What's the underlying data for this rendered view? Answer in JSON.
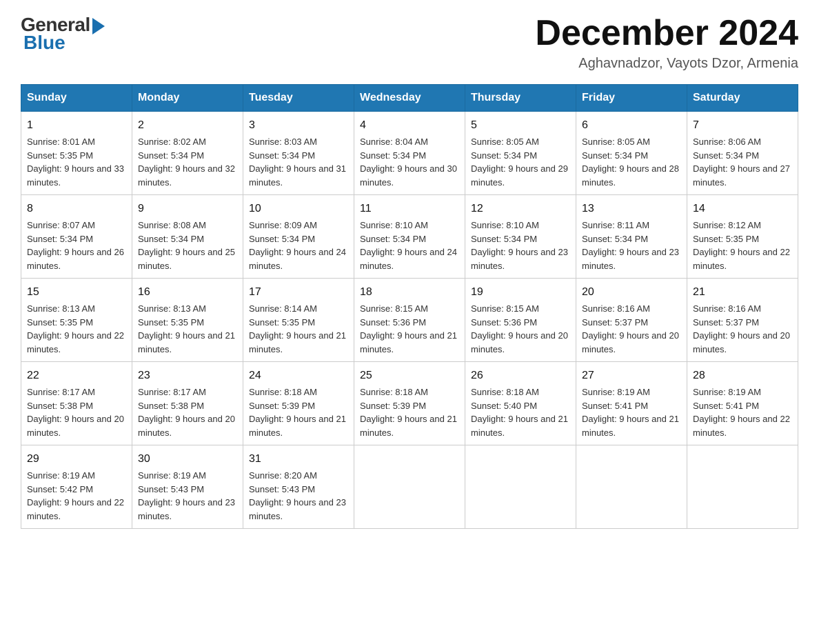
{
  "header": {
    "logo_general": "General",
    "logo_blue": "Blue",
    "main_title": "December 2024",
    "subtitle": "Aghavnadzor, Vayots Dzor, Armenia"
  },
  "calendar": {
    "days_of_week": [
      "Sunday",
      "Monday",
      "Tuesday",
      "Wednesday",
      "Thursday",
      "Friday",
      "Saturday"
    ],
    "weeks": [
      [
        {
          "day": "1",
          "sunrise": "8:01 AM",
          "sunset": "5:35 PM",
          "daylight": "9 hours and 33 minutes."
        },
        {
          "day": "2",
          "sunrise": "8:02 AM",
          "sunset": "5:34 PM",
          "daylight": "9 hours and 32 minutes."
        },
        {
          "day": "3",
          "sunrise": "8:03 AM",
          "sunset": "5:34 PM",
          "daylight": "9 hours and 31 minutes."
        },
        {
          "day": "4",
          "sunrise": "8:04 AM",
          "sunset": "5:34 PM",
          "daylight": "9 hours and 30 minutes."
        },
        {
          "day": "5",
          "sunrise": "8:05 AM",
          "sunset": "5:34 PM",
          "daylight": "9 hours and 29 minutes."
        },
        {
          "day": "6",
          "sunrise": "8:05 AM",
          "sunset": "5:34 PM",
          "daylight": "9 hours and 28 minutes."
        },
        {
          "day": "7",
          "sunrise": "8:06 AM",
          "sunset": "5:34 PM",
          "daylight": "9 hours and 27 minutes."
        }
      ],
      [
        {
          "day": "8",
          "sunrise": "8:07 AM",
          "sunset": "5:34 PM",
          "daylight": "9 hours and 26 minutes."
        },
        {
          "day": "9",
          "sunrise": "8:08 AM",
          "sunset": "5:34 PM",
          "daylight": "9 hours and 25 minutes."
        },
        {
          "day": "10",
          "sunrise": "8:09 AM",
          "sunset": "5:34 PM",
          "daylight": "9 hours and 24 minutes."
        },
        {
          "day": "11",
          "sunrise": "8:10 AM",
          "sunset": "5:34 PM",
          "daylight": "9 hours and 24 minutes."
        },
        {
          "day": "12",
          "sunrise": "8:10 AM",
          "sunset": "5:34 PM",
          "daylight": "9 hours and 23 minutes."
        },
        {
          "day": "13",
          "sunrise": "8:11 AM",
          "sunset": "5:34 PM",
          "daylight": "9 hours and 23 minutes."
        },
        {
          "day": "14",
          "sunrise": "8:12 AM",
          "sunset": "5:35 PM",
          "daylight": "9 hours and 22 minutes."
        }
      ],
      [
        {
          "day": "15",
          "sunrise": "8:13 AM",
          "sunset": "5:35 PM",
          "daylight": "9 hours and 22 minutes."
        },
        {
          "day": "16",
          "sunrise": "8:13 AM",
          "sunset": "5:35 PM",
          "daylight": "9 hours and 21 minutes."
        },
        {
          "day": "17",
          "sunrise": "8:14 AM",
          "sunset": "5:35 PM",
          "daylight": "9 hours and 21 minutes."
        },
        {
          "day": "18",
          "sunrise": "8:15 AM",
          "sunset": "5:36 PM",
          "daylight": "9 hours and 21 minutes."
        },
        {
          "day": "19",
          "sunrise": "8:15 AM",
          "sunset": "5:36 PM",
          "daylight": "9 hours and 20 minutes."
        },
        {
          "day": "20",
          "sunrise": "8:16 AM",
          "sunset": "5:37 PM",
          "daylight": "9 hours and 20 minutes."
        },
        {
          "day": "21",
          "sunrise": "8:16 AM",
          "sunset": "5:37 PM",
          "daylight": "9 hours and 20 minutes."
        }
      ],
      [
        {
          "day": "22",
          "sunrise": "8:17 AM",
          "sunset": "5:38 PM",
          "daylight": "9 hours and 20 minutes."
        },
        {
          "day": "23",
          "sunrise": "8:17 AM",
          "sunset": "5:38 PM",
          "daylight": "9 hours and 20 minutes."
        },
        {
          "day": "24",
          "sunrise": "8:18 AM",
          "sunset": "5:39 PM",
          "daylight": "9 hours and 21 minutes."
        },
        {
          "day": "25",
          "sunrise": "8:18 AM",
          "sunset": "5:39 PM",
          "daylight": "9 hours and 21 minutes."
        },
        {
          "day": "26",
          "sunrise": "8:18 AM",
          "sunset": "5:40 PM",
          "daylight": "9 hours and 21 minutes."
        },
        {
          "day": "27",
          "sunrise": "8:19 AM",
          "sunset": "5:41 PM",
          "daylight": "9 hours and 21 minutes."
        },
        {
          "day": "28",
          "sunrise": "8:19 AM",
          "sunset": "5:41 PM",
          "daylight": "9 hours and 22 minutes."
        }
      ],
      [
        {
          "day": "29",
          "sunrise": "8:19 AM",
          "sunset": "5:42 PM",
          "daylight": "9 hours and 22 minutes."
        },
        {
          "day": "30",
          "sunrise": "8:19 AM",
          "sunset": "5:43 PM",
          "daylight": "9 hours and 23 minutes."
        },
        {
          "day": "31",
          "sunrise": "8:20 AM",
          "sunset": "5:43 PM",
          "daylight": "9 hours and 23 minutes."
        },
        null,
        null,
        null,
        null
      ]
    ]
  }
}
